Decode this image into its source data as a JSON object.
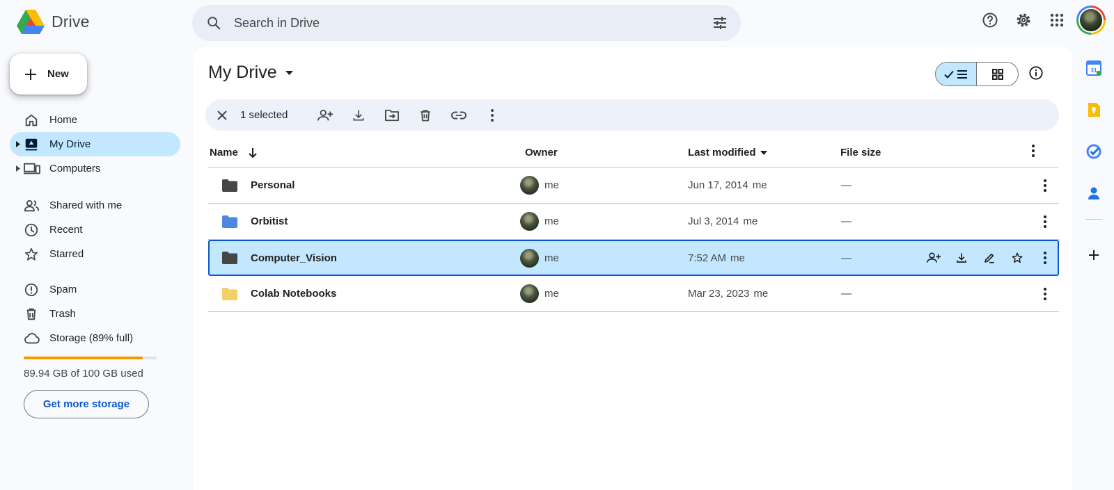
{
  "app": {
    "name": "Drive"
  },
  "search": {
    "placeholder": "Search in Drive"
  },
  "sidebar": {
    "new_label": "New",
    "items": [
      {
        "label": "Home",
        "icon": "home-icon"
      },
      {
        "label": "My Drive",
        "icon": "my-drive-icon",
        "active": true
      },
      {
        "label": "Computers",
        "icon": "computers-icon"
      },
      {
        "label": "Shared with me",
        "icon": "shared-icon"
      },
      {
        "label": "Recent",
        "icon": "clock-icon"
      },
      {
        "label": "Starred",
        "icon": "star-icon"
      },
      {
        "label": "Spam",
        "icon": "spam-icon"
      },
      {
        "label": "Trash",
        "icon": "trash-icon"
      },
      {
        "label": "Storage (89% full)",
        "icon": "cloud-icon"
      }
    ],
    "storage": {
      "used_fraction": 0.8994,
      "text": "89.94 GB of 100 GB used",
      "button": "Get more storage",
      "bar_color": "#f29900"
    }
  },
  "main": {
    "title": "My Drive",
    "selection": {
      "count_label": "1 selected"
    },
    "columns": {
      "name": "Name",
      "owner": "Owner",
      "modified": "Last modified",
      "size": "File size"
    },
    "rows": [
      {
        "name": "Personal",
        "owner": "me",
        "date": "Jun 17, 2014",
        "by": "me",
        "size": "—",
        "folder_color": "#444746"
      },
      {
        "name": "Orbitist",
        "owner": "me",
        "date": "Jul 3, 2014",
        "by": "me",
        "size": "—",
        "folder_color": "#4f86e0"
      },
      {
        "name": "Computer_Vision",
        "owner": "me",
        "date": "7:52 AM",
        "by": "me",
        "size": "—",
        "folder_color": "#444746",
        "selected": true
      },
      {
        "name": "Colab Notebooks",
        "owner": "me",
        "date": "Mar 23, 2023",
        "by": "me",
        "size": "—",
        "folder_color": "#f4cf63"
      }
    ]
  },
  "colors": {
    "accent": "#0b57d0",
    "selected_bg": "#c2e7ff",
    "surface": "#f8fafd"
  }
}
